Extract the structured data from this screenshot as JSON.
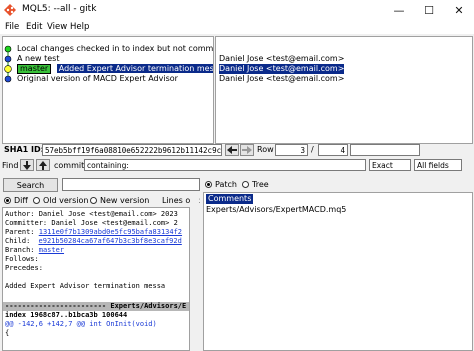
{
  "window": {
    "title": "MQL5: --all - gitk",
    "minimize_glyph": "—",
    "maximize_glyph": "☐",
    "close_glyph": "✕",
    "app_icon": "gitk-diamond-icon"
  },
  "menu": [
    "File",
    "Edit",
    "View",
    "Help"
  ],
  "history": {
    "commits": [
      {
        "message": "Local changes checked in to index but not committed",
        "author": ""
      },
      {
        "message": "A new test",
        "author": "Daniel Jose <test@email.com>"
      },
      {
        "branch": "master",
        "message": "Added Expert Advisor termination message",
        "author": "Daniel Jose <test@email.com>",
        "selected": true
      },
      {
        "message": "Original version of MACD Expert Advisor",
        "author": "Daniel Jose <test@email.com>"
      }
    ],
    "colors": {
      "graph_line": "#1b8c1b",
      "node_green": "#1fd41f",
      "node_blue": "#1f4bd4",
      "selection": "#0a2a8a",
      "branch_tag": "#39c23a"
    }
  },
  "sha": {
    "label": "SHA1 ID:",
    "value": "57eb5bff19f6a08810e652222b9612b11142c9c8",
    "row_label": "Row",
    "row_current": "3",
    "row_total": "4"
  },
  "find": {
    "label": "Find",
    "commit_label": "commit",
    "mode": "containing:",
    "match": "Exact",
    "fields": "All fields"
  },
  "search": {
    "button": "Search",
    "diff_options": [
      "Diff",
      "Old version",
      "New version"
    ],
    "lines_of_context": "Lines of c",
    "patch_label": "Patch",
    "tree_label": "Tree"
  },
  "details": {
    "lines": [
      "Author: Daniel Jose <test@email.com>  2023",
      "Committer: Daniel Jose <test@email.com>  2",
      "Parent: 1311e0f7b1309abd0e5fc95bafa83134f2",
      "Child:  e921b50284ca67af647b3c3bf8e3caf92d",
      "Branch: master",
      "Follows:",
      "Precedes:",
      "",
      "    Added Expert Advisor termination messa"
    ],
    "parent_label": "Parent:",
    "parent_hash": "1311e0f7b1309abd0e5fc95bafa83134f2",
    "child_label": "Child:",
    "child_hash": "e921b50284ca67af647b3c3bf8e3caf92d",
    "branch_label": "Branch:",
    "branch_value": "master",
    "file_header": "------------------------ Experts/Advisors/E",
    "index_line": "index 1968c87..b1bca3b 100644",
    "hunk_line": "@@ -142,6 +142,7 @@ int OnInit(void)",
    "tail_line": "  {"
  },
  "files": {
    "comments_label": "Comments",
    "items": [
      "Experts/Advisors/ExpertMACD.mq5"
    ]
  }
}
